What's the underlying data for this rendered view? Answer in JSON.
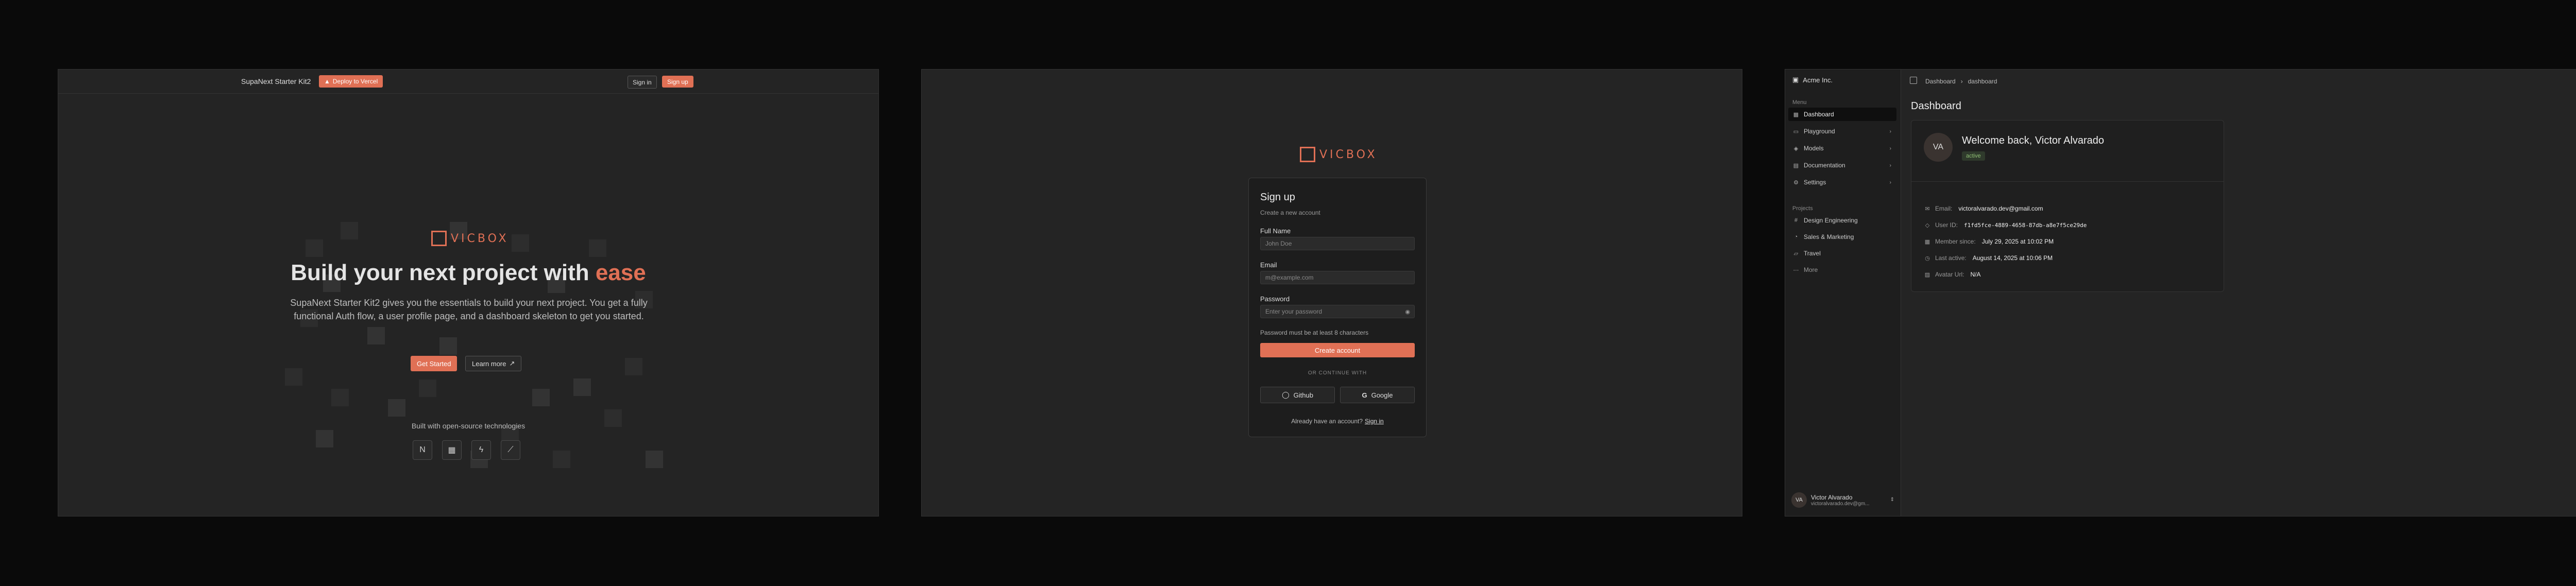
{
  "landing": {
    "nav": {
      "brand": "SupaNext Starter Kit2",
      "deploy_label": "Deploy to Vercel",
      "signin_label": "Sign in",
      "signup_label": "Sign up"
    },
    "logo_text": "VICBOX",
    "hero": {
      "title_main": "Build your next project with",
      "title_accent": "ease",
      "subtitle": "SupaNext Starter Kit2 gives you the essentials to build your next project. You get a fully functional Auth flow, a user profile page, and a dashboard skeleton to get you started."
    },
    "cta": {
      "get_started": "Get Started",
      "learn_more": "Learn more"
    },
    "built_with": "Built with open-source technologies"
  },
  "signup": {
    "logo_text": "VICBOX",
    "title": "Sign up",
    "subtitle": "Create a new account",
    "fullname": {
      "label": "Full Name",
      "placeholder": "John Doe"
    },
    "email": {
      "label": "Email",
      "placeholder": "m@example.com"
    },
    "password": {
      "label": "Password",
      "placeholder": "Enter your password",
      "hint": "Password must be at least 8 characters"
    },
    "create_label": "Create account",
    "or_label": "OR CONTINUE WITH",
    "github_label": "Github",
    "google_label": "Google",
    "already_text": "Already have an account?",
    "signin_link": "Sign in"
  },
  "dashboard": {
    "brand": "Acme Inc.",
    "menu_label": "Menu",
    "menu_items": [
      {
        "label": "Dashboard"
      },
      {
        "label": "Playground"
      },
      {
        "label": "Models"
      },
      {
        "label": "Documentation"
      },
      {
        "label": "Settings"
      }
    ],
    "projects_label": "Projects",
    "project_items": [
      {
        "label": "Design Engineering"
      },
      {
        "label": "Sales & Marketing"
      },
      {
        "label": "Travel"
      },
      {
        "label": "More"
      }
    ],
    "user": {
      "initials": "VA",
      "name": "Victor Alvarado",
      "email": "victoralvarado.dev@gm..."
    },
    "breadcrumb": {
      "first": "Dashboard",
      "second": "dashboard"
    },
    "title": "Dashboard",
    "profile": {
      "initials": "VA",
      "welcome": "Welcome back, Victor Alvarado",
      "status": "active",
      "rows": [
        {
          "label": "Email:",
          "value": "victoralvarado.dev@gmail.com"
        },
        {
          "label": "User ID:",
          "value": "f1fd5fce-4889-4658-87db-a8e7f5ce29de"
        },
        {
          "label": "Member since:",
          "value": "July 29, 2025 at 10:02 PM"
        },
        {
          "label": "Last active:",
          "value": "August 14, 2025 at 10:06 PM"
        },
        {
          "label": "Avatar Url:",
          "value": "N/A"
        }
      ]
    }
  },
  "colors": {
    "accent": "#e07055",
    "bg": "#0a0a0a",
    "panel": "#242424",
    "status_green": "#8fbf74"
  }
}
